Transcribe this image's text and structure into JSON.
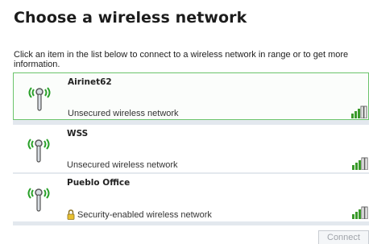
{
  "title": "Choose a wireless network",
  "instruction": "Click an item in the list below to connect to a wireless network in range or to get more information.",
  "networks": [
    {
      "name": "Airinet62",
      "status": "Unsecured wireless network",
      "secured": false,
      "selected": true
    },
    {
      "name": "WSS",
      "status": "Unsecured wireless network",
      "secured": false,
      "selected": false
    },
    {
      "name": "Pueblo Office",
      "status": "Security-enabled wireless network",
      "secured": true,
      "selected": false
    }
  ],
  "connect_label": "Connect",
  "colors": {
    "selected_border": "#6cc46c",
    "signal_green": "#3a9a2a",
    "wifi_waves": "#2aa02a",
    "list_background": "#e3e8ee"
  }
}
